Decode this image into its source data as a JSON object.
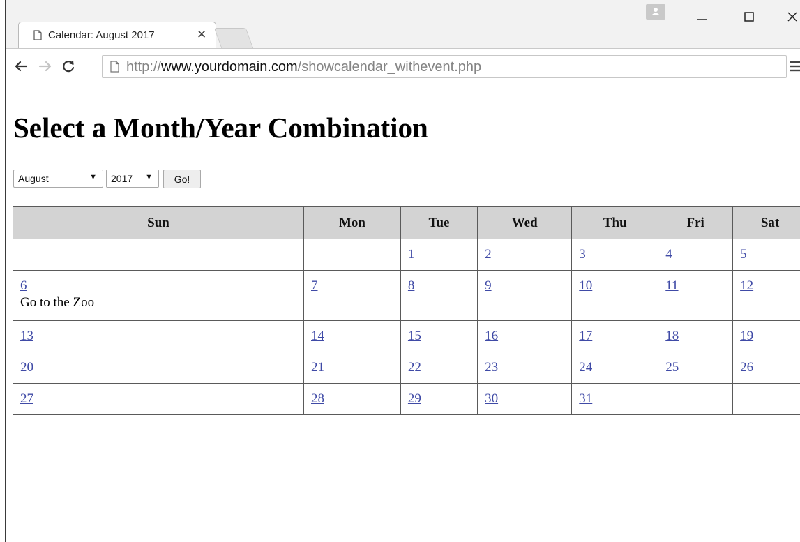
{
  "browser": {
    "tab": {
      "title": "Calendar: August 2017",
      "close": "✕"
    },
    "url": {
      "scheme": "http://",
      "host": "www.yourdomain.com",
      "path": "/showcalendar_withevent.php"
    }
  },
  "page": {
    "heading": "Select a Month/Year Combination",
    "form": {
      "month": "August",
      "year": "2017",
      "submit": "Go!"
    }
  },
  "calendar": {
    "weekdays": [
      "Sun",
      "Mon",
      "Tue",
      "Wed",
      "Thu",
      "Fri",
      "Sat"
    ],
    "weeks": [
      [
        "",
        "",
        "1",
        "2",
        "3",
        "4",
        "5"
      ],
      [
        "6",
        "7",
        "8",
        "9",
        "10",
        "11",
        "12"
      ],
      [
        "13",
        "14",
        "15",
        "16",
        "17",
        "18",
        "19"
      ],
      [
        "20",
        "21",
        "22",
        "23",
        "24",
        "25",
        "26"
      ],
      [
        "27",
        "28",
        "29",
        "30",
        "31",
        "",
        ""
      ]
    ],
    "events": {
      "6": "Go to the Zoo"
    }
  }
}
